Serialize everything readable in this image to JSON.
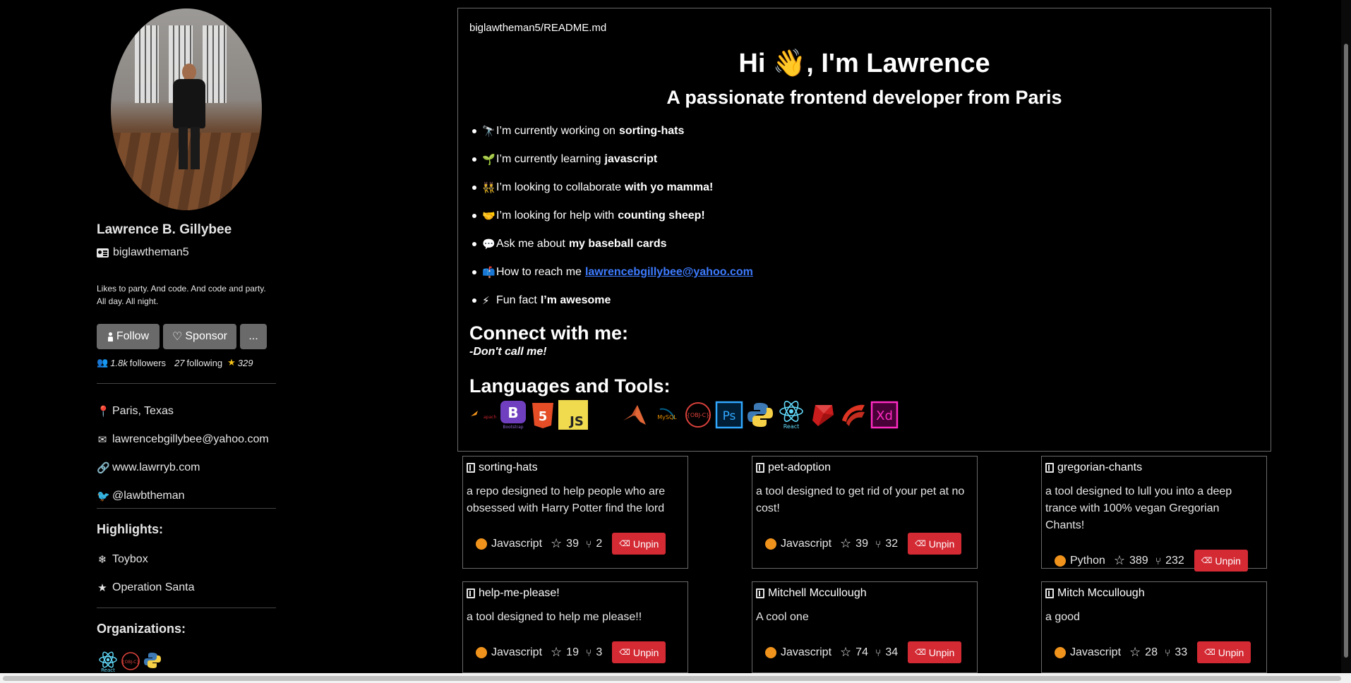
{
  "profile": {
    "name": "Lawrence B. Gillybee",
    "username": "biglawtheman5",
    "bio": "Likes to party. And code. And code and party. All day. All night.",
    "follow_label": "Follow",
    "sponsor_label": "Sponsor",
    "more_label": "...",
    "followers": "1.8k",
    "followers_label": "followers",
    "following": "27",
    "following_label": "following",
    "stars": "329",
    "location": "Paris, Texas",
    "email": "lawrencebgillybee@yahoo.com",
    "website": "www.lawrryb.com",
    "twitter": "@lawbtheman"
  },
  "highlights": {
    "title": "Highlights:",
    "items": [
      "Toybox",
      "Operation Santa"
    ]
  },
  "organizations": {
    "title": "Organizations:",
    "items": [
      "react",
      "objective-c",
      "python"
    ]
  },
  "readme": {
    "path": "biglawtheman5/README.md",
    "greeting": "Hi 👋, I'm Lawrence",
    "subtitle": "A passionate frontend developer from Paris",
    "bullets": [
      {
        "emoji": "🔭",
        "text": "I’m currently working on",
        "bold": "sorting-hats"
      },
      {
        "emoji": "🌱",
        "text": "I’m currently learning",
        "bold": "javascript"
      },
      {
        "emoji": "👯",
        "text": "I’m looking to collaborate",
        "bold": "with yo mamma!"
      },
      {
        "emoji": "🤝",
        "text": "I’m looking for help with",
        "bold": "counting sheep!"
      },
      {
        "emoji": "💬",
        "text": "Ask me about",
        "bold": "my baseball cards"
      },
      {
        "emoji": "📫",
        "text": "How to reach me",
        "link": "lawrencebgillybee@yahoo.com"
      },
      {
        "emoji": "⚡",
        "text": "Fun fact",
        "bold": "I’m awesome"
      }
    ],
    "connect_title": "Connect with me:",
    "connect_text": "-Don't call me!",
    "tools_title": "Languages and Tools:",
    "tools": [
      "apache",
      "bootstrap",
      "html5",
      "javascript",
      "blank",
      "matlab",
      "mysql",
      "objective-c",
      "photoshop",
      "python",
      "react",
      "ruby",
      "scala",
      "xd"
    ]
  },
  "pinned": [
    {
      "name": "sorting-hats",
      "desc": "a repo designed to help people who are obsessed with Harry Potter find the lord",
      "lang": "Javascript",
      "stars": "39",
      "forks": "2"
    },
    {
      "name": "pet-adoption",
      "desc": "a tool designed to get rid of your pet at no cost!",
      "lang": "Javascript",
      "stars": "39",
      "forks": "32"
    },
    {
      "name": "gregorian-chants",
      "desc": "a tool designed to lull you into a deep trance with 100% vegan Gregorian Chants!",
      "lang": "Python",
      "stars": "389",
      "forks": "232"
    },
    {
      "name": "help-me-please!",
      "desc": "a tool designed to help me please!!",
      "lang": "Javascript",
      "stars": "19",
      "forks": "3"
    },
    {
      "name": "Mitchell Mccullough",
      "desc": "A cool one",
      "lang": "Javascript",
      "stars": "74",
      "forks": "34"
    },
    {
      "name": "Mitch Mccullough",
      "desc": "a good",
      "lang": "Javascript",
      "stars": "28",
      "forks": "33"
    }
  ],
  "unpin_label": "Unpin",
  "colors": {
    "accent": "#d42a34",
    "link": "#3d7bff",
    "lang_dot": "#f0931c",
    "button": "#6a6a6a"
  }
}
